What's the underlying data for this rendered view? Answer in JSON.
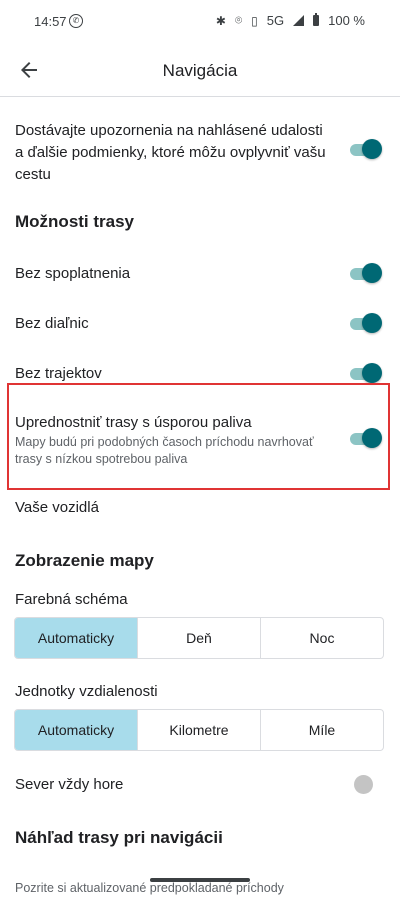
{
  "status": {
    "time": "14:57",
    "network": "5G",
    "battery": "100 %"
  },
  "appbar": {
    "title": "Navigácia"
  },
  "alerts": {
    "text_line1": "Dostávajte upozornenia na nahlásené udalosti",
    "text_line2": "a ďalšie podmienky, ktoré môžu ovplyvniť vašu",
    "text_line3": "cestu",
    "enabled": true
  },
  "route_options": {
    "heading": "Možnosti trasy",
    "no_tolls": {
      "label": "Bez spoplatnenia",
      "enabled": true
    },
    "no_highways": {
      "label": "Bez diaľnic",
      "enabled": true
    },
    "no_ferries": {
      "label": "Bez trajektov",
      "enabled": true
    },
    "fuel": {
      "label": "Uprednostniť trasy s úsporou paliva",
      "desc_line1": "Mapy budú pri podobných časoch príchodu navrhovať",
      "desc_line2": "trasy s nízkou spotrebou paliva",
      "enabled": true
    },
    "vehicles": "Vaše vozidlá"
  },
  "map_display": {
    "heading": "Zobrazenie mapy",
    "color_scheme": {
      "label": "Farebná schéma",
      "options": [
        "Automaticky",
        "Deň",
        "Noc"
      ],
      "selected": "Automaticky"
    },
    "units": {
      "label": "Jednotky vzdialenosti",
      "options": [
        "Automaticky",
        "Kilometre",
        "Míle"
      ],
      "selected": "Automaticky"
    },
    "north_up": {
      "label": "Sever vždy hore",
      "enabled": false
    }
  },
  "preview": {
    "heading": "Náhľad trasy pri navigácii",
    "partial_text": "Pozrite si aktualizované predpokladané príchody"
  },
  "colors": {
    "accent": "#006874",
    "accent_track": "#8cc4c4",
    "selected_segment": "#a8dceb",
    "highlight": "#e03434"
  }
}
